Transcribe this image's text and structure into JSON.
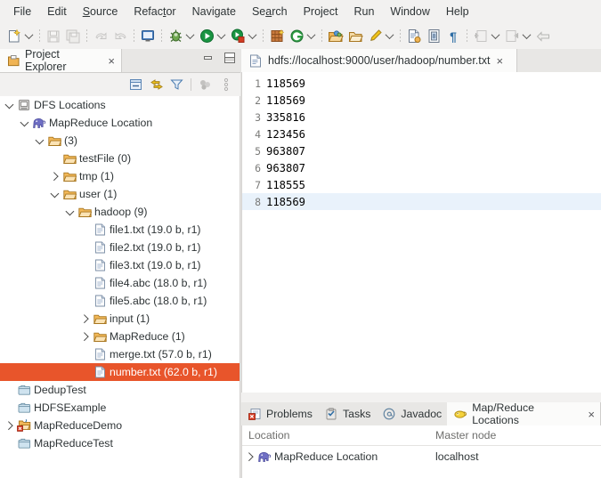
{
  "app": {
    "title": "Eclipse IDE",
    "accent_selection": "#e8552b",
    "current_line_highlight": "#e9f2fb",
    "panel_bg": "#f2f1f0"
  },
  "menubar": {
    "items": [
      {
        "label": "File",
        "mnemonic": ""
      },
      {
        "label": "Edit",
        "mnemonic": ""
      },
      {
        "label": "Source",
        "mnemonic": "S"
      },
      {
        "label": "Refactor",
        "mnemonic": "t"
      },
      {
        "label": "Navigate",
        "mnemonic": ""
      },
      {
        "label": "Search",
        "mnemonic": "a"
      },
      {
        "label": "Project",
        "mnemonic": ""
      },
      {
        "label": "Run",
        "mnemonic": ""
      },
      {
        "label": "Window",
        "mnemonic": ""
      },
      {
        "label": "Help",
        "mnemonic": ""
      }
    ]
  },
  "toolbar": {
    "groups": [
      [
        "new-wizard-icon",
        "dropdown-arrow"
      ],
      [
        "save-icon",
        "save-all-icon"
      ],
      [
        "undo-icon",
        "redo-icon"
      ],
      [
        "console-icon"
      ],
      [
        "debug-icon",
        "dropdown-arrow",
        "run-icon",
        "dropdown-arrow",
        "coverage-icon",
        "dropdown-arrow"
      ],
      [
        "new-java-project-icon",
        "new-class-icon",
        "dropdown-arrow"
      ],
      [
        "open-type-icon",
        "open-task-icon",
        "skip-breakpoints-icon",
        "dropdown-arrow"
      ],
      [
        "new-java-file-icon",
        "new-annotation-icon",
        "pilcrow-icon"
      ],
      [
        "previous-annotation-icon",
        "dropdown-arrow",
        "next-annotation-icon",
        "dropdown-arrow",
        "back-icon"
      ]
    ]
  },
  "project_explorer": {
    "tab": {
      "title": "Project Explorer",
      "icon": "project-explorer-icon",
      "close": "×"
    },
    "window_controls": [
      "minimize-icon",
      "maximize-icon"
    ],
    "view_toolbar": [
      "collapse-all-icon",
      "link-with-editor-icon",
      "filter-icon",
      "view-menu-icon",
      "view-menu-chevron-icon"
    ],
    "tree": [
      {
        "label": "DFS Locations",
        "depth": 0,
        "twisty": "down",
        "icon": "dfs-locations-icon",
        "selected": false
      },
      {
        "label": "MapReduce Location",
        "depth": 1,
        "twisty": "down",
        "icon": "elephant-icon",
        "selected": false
      },
      {
        "label": "(3)",
        "depth": 2,
        "twisty": "down",
        "icon": "folder-icon",
        "selected": false
      },
      {
        "label": "testFile (0)",
        "depth": 3,
        "twisty": "none",
        "icon": "folder-icon",
        "selected": false
      },
      {
        "label": "tmp (1)",
        "depth": 3,
        "twisty": "right",
        "icon": "folder-icon",
        "selected": false
      },
      {
        "label": "user (1)",
        "depth": 3,
        "twisty": "down",
        "icon": "folder-icon",
        "selected": false
      },
      {
        "label": "hadoop (9)",
        "depth": 4,
        "twisty": "down",
        "icon": "folder-icon",
        "selected": false
      },
      {
        "label": "file1.txt (19.0 b, r1)",
        "depth": 5,
        "twisty": "none",
        "icon": "file-icon",
        "selected": false
      },
      {
        "label": "file2.txt (19.0 b, r1)",
        "depth": 5,
        "twisty": "none",
        "icon": "file-icon",
        "selected": false
      },
      {
        "label": "file3.txt (19.0 b, r1)",
        "depth": 5,
        "twisty": "none",
        "icon": "file-icon",
        "selected": false
      },
      {
        "label": "file4.abc (18.0 b, r1)",
        "depth": 5,
        "twisty": "none",
        "icon": "file-icon",
        "selected": false
      },
      {
        "label": "file5.abc (18.0 b, r1)",
        "depth": 5,
        "twisty": "none",
        "icon": "file-icon",
        "selected": false
      },
      {
        "label": "input (1)",
        "depth": 5,
        "twisty": "right",
        "icon": "folder-icon",
        "selected": false
      },
      {
        "label": "MapReduce (1)",
        "depth": 5,
        "twisty": "right",
        "icon": "folder-icon",
        "selected": false
      },
      {
        "label": "merge.txt (57.0 b, r1)",
        "depth": 5,
        "twisty": "none",
        "icon": "file-icon",
        "selected": false
      },
      {
        "label": "number.txt (62.0 b, r1)",
        "depth": 5,
        "twisty": "none",
        "icon": "file-icon",
        "selected": true
      },
      {
        "label": "DedupTest",
        "depth": 0,
        "twisty": "none",
        "icon": "closed-project-icon",
        "selected": false
      },
      {
        "label": "HDFSExample",
        "depth": 0,
        "twisty": "none",
        "icon": "closed-project-icon",
        "selected": false
      },
      {
        "label": "MapReduceDemo",
        "depth": 0,
        "twisty": "right",
        "icon": "java-project-error-icon",
        "selected": false
      },
      {
        "label": "MapReduceTest",
        "depth": 0,
        "twisty": "none",
        "icon": "closed-project-icon",
        "selected": false
      }
    ]
  },
  "editor": {
    "tab": {
      "title": "hdfs://localhost:9000/user/hadoop/number.txt",
      "icon": "text-file-icon",
      "close": "×"
    },
    "lines": [
      {
        "num": "1",
        "text": "118569",
        "current": false
      },
      {
        "num": "2",
        "text": "118569",
        "current": false
      },
      {
        "num": "3",
        "text": "335816",
        "current": false
      },
      {
        "num": "4",
        "text": "123456",
        "current": false
      },
      {
        "num": "5",
        "text": "963807",
        "current": false
      },
      {
        "num": "6",
        "text": "963807",
        "current": false
      },
      {
        "num": "7",
        "text": "118555",
        "current": false
      },
      {
        "num": "8",
        "text": "118569",
        "current": true
      }
    ]
  },
  "bottom_panel": {
    "tabs": [
      {
        "label": "Problems",
        "icon": "problems-icon",
        "active": false,
        "closable": false
      },
      {
        "label": "Tasks",
        "icon": "tasks-icon",
        "active": false,
        "closable": false
      },
      {
        "label": "Javadoc",
        "icon": "javadoc-icon",
        "active": false,
        "closable": false
      },
      {
        "label": "Map/Reduce Locations",
        "icon": "map-reduce-locations-icon",
        "active": true,
        "closable": true
      }
    ],
    "close_glyph": "×",
    "columns": [
      "Location",
      "Master node"
    ],
    "rows": [
      {
        "twisty": "right",
        "icon": "elephant-icon",
        "location": "MapReduce Location",
        "master_node": "localhost"
      }
    ]
  }
}
